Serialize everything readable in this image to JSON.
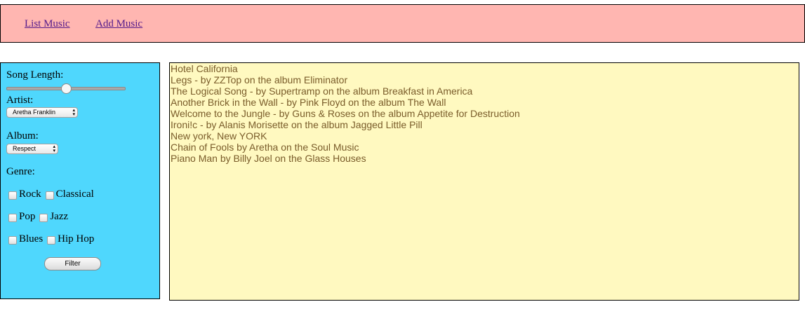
{
  "nav": {
    "list_music": "List Music",
    "add_music": "Add Music"
  },
  "filters": {
    "song_length_label": "Song Length:",
    "song_length_value": 0.5,
    "artist_label": "Artist:",
    "artist_selected": "Aretha Franklin",
    "album_label": "Album:",
    "album_selected": "Respect",
    "genre_label": "Genre:",
    "genres": [
      {
        "label": "Rock",
        "checked": false
      },
      {
        "label": "Classical",
        "checked": false
      },
      {
        "label": "Pop",
        "checked": false
      },
      {
        "label": "Jazz",
        "checked": false
      },
      {
        "label": "Blues",
        "checked": false
      },
      {
        "label": "Hip Hop",
        "checked": false
      }
    ],
    "filter_button": "Filter"
  },
  "songs": [
    "Hotel California",
    "Legs - by ZZTop on the album Eliminator",
    "The Logical Song - by Supertramp on the album Breakfast in America",
    "Another Brick in the Wall - by Pink Floyd on the album The Wall",
    "Welcome to the Jungle - by Guns & Roses on the album Appetite for Destruction",
    "Ironi!c - by Alanis Morisette on the album Jagged Little Pill",
    "New york, New YORK",
    "Chain of Fools by Aretha on the Soul Music",
    "Piano Man by Billy Joel on the Glass Houses"
  ]
}
